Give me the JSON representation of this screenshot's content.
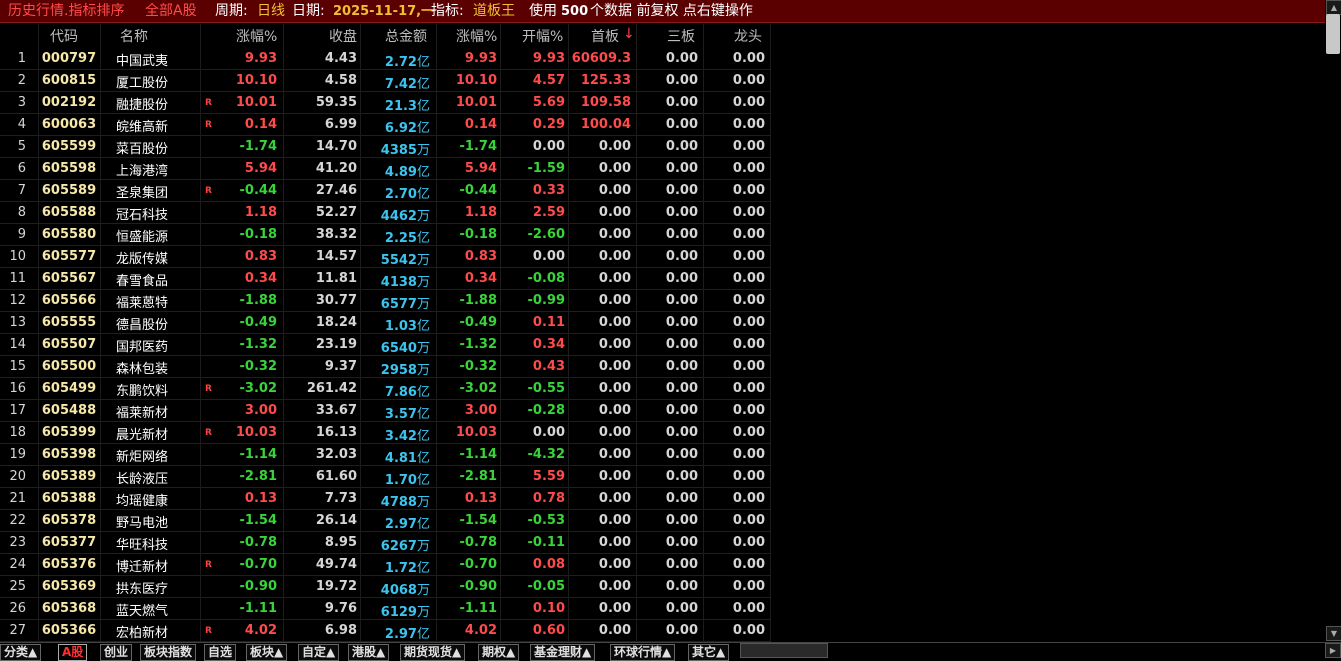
{
  "titlebar": {
    "module": "历史行情.指标排序",
    "market": "全部A股",
    "period_label": "周期:",
    "period_value": "日线",
    "date_label": "日期:",
    "date_value": "2025-11-17,一",
    "indicator_label": "指标:",
    "indicator_value": "道板王",
    "data_note_pre": "使用",
    "data_note_count": "500",
    "data_note_post": "个数据 前复权 点右键操作"
  },
  "columns": [
    "代码",
    "名称",
    "涨幅%",
    "收盘",
    "总金额",
    "涨幅%",
    "开幅%",
    "首板",
    "三板",
    "龙头"
  ],
  "sort_indicator": "↓",
  "rows": [
    {
      "idx": "1",
      "code": "000797",
      "name": "中国武夷",
      "flag": "",
      "pct1": "9.93",
      "close": "4.43",
      "amt": "2.72",
      "unit": "亿",
      "pct2": "9.93",
      "open": "9.93",
      "b1": "60609.3",
      "b3": "0.00",
      "dt": "0.00"
    },
    {
      "idx": "2",
      "code": "600815",
      "name": "厦工股份",
      "flag": "",
      "pct1": "10.10",
      "close": "4.58",
      "amt": "7.42",
      "unit": "亿",
      "pct2": "10.10",
      "open": "4.57",
      "b1": "125.33",
      "b3": "0.00",
      "dt": "0.00"
    },
    {
      "idx": "3",
      "code": "002192",
      "name": "融捷股份",
      "flag": "R",
      "pct1": "10.01",
      "close": "59.35",
      "amt": "21.3",
      "unit": "亿",
      "pct2": "10.01",
      "open": "5.69",
      "b1": "109.58",
      "b3": "0.00",
      "dt": "0.00"
    },
    {
      "idx": "4",
      "code": "600063",
      "name": "皖维高新",
      "flag": "R",
      "pct1": "0.14",
      "close": "6.99",
      "amt": "6.92",
      "unit": "亿",
      "pct2": "0.14",
      "open": "0.29",
      "b1": "100.04",
      "b3": "0.00",
      "dt": "0.00"
    },
    {
      "idx": "5",
      "code": "605599",
      "name": "菜百股份",
      "flag": "",
      "pct1": "-1.74",
      "close": "14.70",
      "amt": "4385",
      "unit": "万",
      "pct2": "-1.74",
      "open": "0.00",
      "b1": "0.00",
      "b3": "0.00",
      "dt": "0.00"
    },
    {
      "idx": "6",
      "code": "605598",
      "name": "上海港湾",
      "flag": "",
      "pct1": "5.94",
      "close": "41.20",
      "amt": "4.89",
      "unit": "亿",
      "pct2": "5.94",
      "open": "-1.59",
      "b1": "0.00",
      "b3": "0.00",
      "dt": "0.00"
    },
    {
      "idx": "7",
      "code": "605589",
      "name": "圣泉集团",
      "flag": "R",
      "pct1": "-0.44",
      "close": "27.46",
      "amt": "2.70",
      "unit": "亿",
      "pct2": "-0.44",
      "open": "0.33",
      "b1": "0.00",
      "b3": "0.00",
      "dt": "0.00"
    },
    {
      "idx": "8",
      "code": "605588",
      "name": "冠石科技",
      "flag": "",
      "pct1": "1.18",
      "close": "52.27",
      "amt": "4462",
      "unit": "万",
      "pct2": "1.18",
      "open": "2.59",
      "b1": "0.00",
      "b3": "0.00",
      "dt": "0.00"
    },
    {
      "idx": "9",
      "code": "605580",
      "name": "恒盛能源",
      "flag": "",
      "pct1": "-0.18",
      "close": "38.32",
      "amt": "2.25",
      "unit": "亿",
      "pct2": "-0.18",
      "open": "-2.60",
      "b1": "0.00",
      "b3": "0.00",
      "dt": "0.00"
    },
    {
      "idx": "10",
      "code": "605577",
      "name": "龙版传媒",
      "flag": "",
      "pct1": "0.83",
      "close": "14.57",
      "amt": "5542",
      "unit": "万",
      "pct2": "0.83",
      "open": "0.00",
      "b1": "0.00",
      "b3": "0.00",
      "dt": "0.00"
    },
    {
      "idx": "11",
      "code": "605567",
      "name": "春雪食品",
      "flag": "",
      "pct1": "0.34",
      "close": "11.81",
      "amt": "4138",
      "unit": "万",
      "pct2": "0.34",
      "open": "-0.08",
      "b1": "0.00",
      "b3": "0.00",
      "dt": "0.00"
    },
    {
      "idx": "12",
      "code": "605566",
      "name": "福莱蒽特",
      "flag": "",
      "pct1": "-1.88",
      "close": "30.77",
      "amt": "6577",
      "unit": "万",
      "pct2": "-1.88",
      "open": "-0.99",
      "b1": "0.00",
      "b3": "0.00",
      "dt": "0.00"
    },
    {
      "idx": "13",
      "code": "605555",
      "name": "德昌股份",
      "flag": "",
      "pct1": "-0.49",
      "close": "18.24",
      "amt": "1.03",
      "unit": "亿",
      "pct2": "-0.49",
      "open": "0.11",
      "b1": "0.00",
      "b3": "0.00",
      "dt": "0.00"
    },
    {
      "idx": "14",
      "code": "605507",
      "name": "国邦医药",
      "flag": "",
      "pct1": "-1.32",
      "close": "23.19",
      "amt": "6540",
      "unit": "万",
      "pct2": "-1.32",
      "open": "0.34",
      "b1": "0.00",
      "b3": "0.00",
      "dt": "0.00"
    },
    {
      "idx": "15",
      "code": "605500",
      "name": "森林包装",
      "flag": "",
      "pct1": "-0.32",
      "close": "9.37",
      "amt": "2958",
      "unit": "万",
      "pct2": "-0.32",
      "open": "0.43",
      "b1": "0.00",
      "b3": "0.00",
      "dt": "0.00"
    },
    {
      "idx": "16",
      "code": "605499",
      "name": "东鹏饮料",
      "flag": "R",
      "pct1": "-3.02",
      "close": "261.42",
      "amt": "7.86",
      "unit": "亿",
      "pct2": "-3.02",
      "open": "-0.55",
      "b1": "0.00",
      "b3": "0.00",
      "dt": "0.00"
    },
    {
      "idx": "17",
      "code": "605488",
      "name": "福莱新材",
      "flag": "",
      "pct1": "3.00",
      "close": "33.67",
      "amt": "3.57",
      "unit": "亿",
      "pct2": "3.00",
      "open": "-0.28",
      "b1": "0.00",
      "b3": "0.00",
      "dt": "0.00"
    },
    {
      "idx": "18",
      "code": "605399",
      "name": "晨光新材",
      "flag": "R",
      "pct1": "10.03",
      "close": "16.13",
      "amt": "3.42",
      "unit": "亿",
      "pct2": "10.03",
      "open": "0.00",
      "b1": "0.00",
      "b3": "0.00",
      "dt": "0.00"
    },
    {
      "idx": "19",
      "code": "605398",
      "name": "新炬网络",
      "flag": "",
      "pct1": "-1.14",
      "close": "32.03",
      "amt": "4.81",
      "unit": "亿",
      "pct2": "-1.14",
      "open": "-4.32",
      "b1": "0.00",
      "b3": "0.00",
      "dt": "0.00"
    },
    {
      "idx": "20",
      "code": "605389",
      "name": "长龄液压",
      "flag": "",
      "pct1": "-2.81",
      "close": "61.60",
      "amt": "1.70",
      "unit": "亿",
      "pct2": "-2.81",
      "open": "5.59",
      "b1": "0.00",
      "b3": "0.00",
      "dt": "0.00"
    },
    {
      "idx": "21",
      "code": "605388",
      "name": "均瑶健康",
      "flag": "",
      "pct1": "0.13",
      "close": "7.73",
      "amt": "4788",
      "unit": "万",
      "pct2": "0.13",
      "open": "0.78",
      "b1": "0.00",
      "b3": "0.00",
      "dt": "0.00"
    },
    {
      "idx": "22",
      "code": "605378",
      "name": "野马电池",
      "flag": "",
      "pct1": "-1.54",
      "close": "26.14",
      "amt": "2.97",
      "unit": "亿",
      "pct2": "-1.54",
      "open": "-0.53",
      "b1": "0.00",
      "b3": "0.00",
      "dt": "0.00"
    },
    {
      "idx": "23",
      "code": "605377",
      "name": "华旺科技",
      "flag": "",
      "pct1": "-0.78",
      "close": "8.95",
      "amt": "6267",
      "unit": "万",
      "pct2": "-0.78",
      "open": "-0.11",
      "b1": "0.00",
      "b3": "0.00",
      "dt": "0.00"
    },
    {
      "idx": "24",
      "code": "605376",
      "name": "博迁新材",
      "flag": "R",
      "pct1": "-0.70",
      "close": "49.74",
      "amt": "1.72",
      "unit": "亿",
      "pct2": "-0.70",
      "open": "0.08",
      "b1": "0.00",
      "b3": "0.00",
      "dt": "0.00"
    },
    {
      "idx": "25",
      "code": "605369",
      "name": "拱东医疗",
      "flag": "",
      "pct1": "-0.90",
      "close": "19.72",
      "amt": "4068",
      "unit": "万",
      "pct2": "-0.90",
      "open": "-0.05",
      "b1": "0.00",
      "b3": "0.00",
      "dt": "0.00"
    },
    {
      "idx": "26",
      "code": "605368",
      "name": "蓝天燃气",
      "flag": "",
      "pct1": "-1.11",
      "close": "9.76",
      "amt": "6129",
      "unit": "万",
      "pct2": "-1.11",
      "open": "0.10",
      "b1": "0.00",
      "b3": "0.00",
      "dt": "0.00"
    },
    {
      "idx": "27",
      "code": "605366",
      "name": "宏柏新材",
      "flag": "R",
      "pct1": "4.02",
      "close": "6.98",
      "amt": "2.97",
      "unit": "亿",
      "pct2": "4.02",
      "open": "0.60",
      "b1": "0.00",
      "b3": "0.00",
      "dt": "0.00"
    }
  ],
  "tabs": [
    {
      "label": "分类▲",
      "active": false
    },
    {
      "label": "A股",
      "active": true
    },
    {
      "label": "创业",
      "active": false
    },
    {
      "label": "板块指数",
      "active": false
    },
    {
      "label": "自选",
      "active": false
    },
    {
      "label": "板块▲",
      "active": false
    },
    {
      "label": "自定▲",
      "active": false
    },
    {
      "label": "港股▲",
      "active": false
    },
    {
      "label": "期货现货▲",
      "active": false
    },
    {
      "label": "期权▲",
      "active": false
    },
    {
      "label": "基金理财▲",
      "active": false
    },
    {
      "label": "环球行情▲",
      "active": false
    },
    {
      "label": "其它▲",
      "active": false
    }
  ],
  "colors": {
    "up": "#ff4b4b",
    "down": "#39d439",
    "amount": "#3cc4f0",
    "code": "#f5e8a8",
    "titlebar_bg": "#5a0000"
  }
}
